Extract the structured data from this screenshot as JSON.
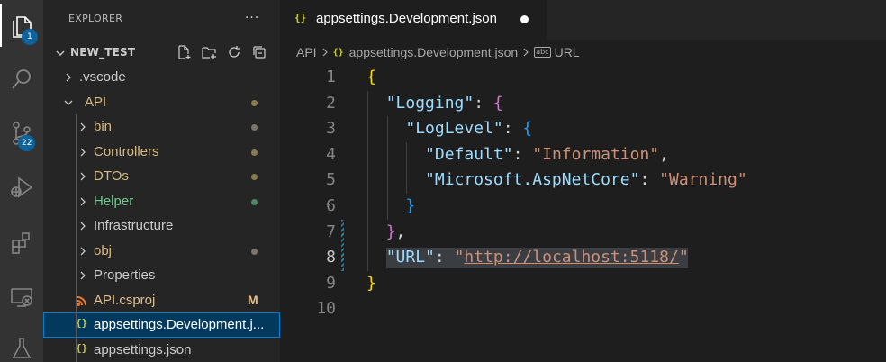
{
  "activity_bar": {
    "items": [
      {
        "icon": "files-icon",
        "badge": "1"
      },
      {
        "icon": "search-icon"
      },
      {
        "icon": "source-control-icon",
        "badge": "22"
      },
      {
        "icon": "run-debug-icon"
      },
      {
        "icon": "extensions-icon"
      },
      {
        "icon": "remote-explorer-icon"
      },
      {
        "icon": "testing-icon"
      }
    ]
  },
  "sidebar": {
    "title": "EXPLORER",
    "more_label": "···",
    "project": {
      "name": "NEW_TEST",
      "actions": [
        "new-file-icon",
        "new-folder-icon",
        "refresh-icon",
        "collapse-all-icon"
      ]
    },
    "items": [
      {
        "label": "vscode",
        "prefix": ".",
        "type": "folder",
        "expanded": false,
        "level": 0,
        "color": "#cccccc"
      },
      {
        "label": "API",
        "type": "folder",
        "expanded": true,
        "level": 0,
        "color": "#d7ba7d",
        "decoration": "dot"
      },
      {
        "label": "bin",
        "type": "folder",
        "expanded": false,
        "level": 1,
        "color": "#d7ba7d",
        "decoration": "dot-gray"
      },
      {
        "label": "Controllers",
        "type": "folder",
        "expanded": false,
        "level": 1,
        "color": "#d7ba7d",
        "decoration": "dot"
      },
      {
        "label": "DTOs",
        "type": "folder",
        "expanded": false,
        "level": 1,
        "color": "#d7ba7d",
        "decoration": "dot"
      },
      {
        "label": "Helper",
        "type": "folder",
        "expanded": false,
        "level": 1,
        "color": "#73c991",
        "decoration": "dot-green"
      },
      {
        "label": "Infrastructure",
        "type": "folder",
        "expanded": false,
        "level": 1,
        "color": "#cccccc"
      },
      {
        "label": "obj",
        "type": "folder",
        "expanded": false,
        "level": 1,
        "color": "#d7ba7d",
        "decoration": "dot-gray"
      },
      {
        "label": "Properties",
        "type": "folder",
        "expanded": false,
        "level": 1,
        "color": "#cccccc"
      },
      {
        "label": "API.csproj",
        "type": "file",
        "icon": "rss-icon",
        "level": 1,
        "color": "#e2c08d",
        "status": "M"
      },
      {
        "label": "appsettings.Development.j...",
        "type": "file",
        "icon": "json-icon",
        "level": 1,
        "color": "#ffffff",
        "selected": true
      },
      {
        "label": "appsettings.json",
        "type": "file",
        "icon": "json-icon",
        "level": 1,
        "color": "#cccccc"
      }
    ],
    "colors": {
      "modified": "#e2c08d",
      "untracked": "#73c991",
      "ignored": "#8c8c8c",
      "selection": "#04395e"
    }
  },
  "editor": {
    "tab": {
      "label": "appsettings.Development.json",
      "icon_glyph": "{}",
      "dirty": true
    },
    "breadcrumbs": [
      "API",
      "appsettings.Development.json",
      "URL"
    ],
    "current_line": 8,
    "lines": [
      {
        "n": "1",
        "tokens": [
          {
            "t": "{",
            "c": "b1"
          }
        ]
      },
      {
        "n": "2",
        "tokens": [
          {
            "t": "  "
          },
          {
            "t": "\"Logging\"",
            "c": "k"
          },
          {
            "t": ": ",
            "c": "p"
          },
          {
            "t": "{",
            "c": "b2"
          }
        ]
      },
      {
        "n": "3",
        "tokens": [
          {
            "t": "    "
          },
          {
            "t": "\"LogLevel\"",
            "c": "k"
          },
          {
            "t": ": ",
            "c": "p"
          },
          {
            "t": "{",
            "c": "b3"
          }
        ]
      },
      {
        "n": "4",
        "tokens": [
          {
            "t": "      "
          },
          {
            "t": "\"Default\"",
            "c": "k"
          },
          {
            "t": ": ",
            "c": "p"
          },
          {
            "t": "\"Information\"",
            "c": "s"
          },
          {
            "t": ",",
            "c": "p"
          }
        ]
      },
      {
        "n": "5",
        "tokens": [
          {
            "t": "      "
          },
          {
            "t": "\"Microsoft.AspNetCore\"",
            "c": "k"
          },
          {
            "t": ": ",
            "c": "p"
          },
          {
            "t": "\"Warning\"",
            "c": "s"
          }
        ]
      },
      {
        "n": "6",
        "tokens": [
          {
            "t": "    "
          },
          {
            "t": "}",
            "c": "b3"
          }
        ]
      },
      {
        "n": "7",
        "tokens": [
          {
            "t": "  "
          },
          {
            "t": "}",
            "c": "b2"
          },
          {
            "t": ",",
            "c": "p"
          }
        ]
      },
      {
        "n": "8",
        "tokens": [
          {
            "t": "  "
          },
          {
            "t": "\"URL\"",
            "c": "k"
          },
          {
            "t": ": ",
            "c": "p"
          },
          {
            "t": "\"",
            "c": "s"
          },
          {
            "t": "http://localhost:5118/",
            "c": "s link"
          },
          {
            "t": "\"",
            "c": "s"
          }
        ]
      },
      {
        "n": "9",
        "tokens": [
          {
            "t": "}",
            "c": "b1"
          }
        ]
      },
      {
        "n": "10",
        "tokens": []
      }
    ],
    "colors": {
      "key": "#9cdcfe",
      "string": "#ce9178",
      "bracket_1": "#ffd700",
      "bracket_2": "#da70d6",
      "bracket_3": "#179fff"
    }
  }
}
